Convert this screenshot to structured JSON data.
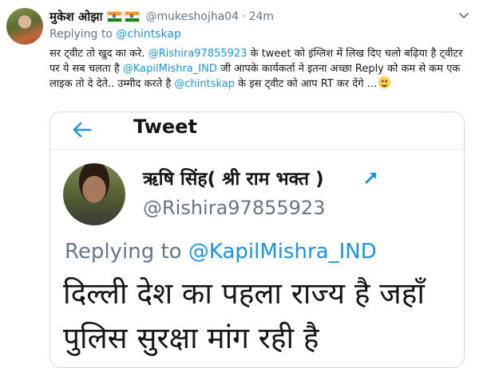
{
  "tweet": {
    "author_name": "मुकेश ओझा",
    "handle": "@mukeshojha04",
    "separator": "·",
    "time": "24m",
    "replying_prefix": "Replying to",
    "replying_to": "@chintskap",
    "body": {
      "t1": "सर ट्वीट तो खुद का करे. ",
      "m1": "@Rishira97855923",
      "t2": " के tweet को इंग्लिश में लिख दिए चलो बढ़िया है ट्वीटर पर ये सब चलता है ",
      "m2": "@KapilMishra_IND",
      "t3": " जी आपके कार्यकर्ता ने इतना अच्छा Reply को कम से कम एक लाइक तो दे देते.. उम्मीद करते है ",
      "m3": "@chintskap",
      "t4": " के इस ट्वीट को आप RT कर देंगे ..."
    }
  },
  "screenshot": {
    "header_title": "Tweet",
    "author_name": "ऋषि सिंह( श्री राम भक्त )",
    "handle": "@Rishira97855923",
    "replying_prefix": "Replying to",
    "replying_to": "@KapilMishra_IND",
    "body": "दिल्ली देश का पहला राज्य है जहाँ पुलिस सुरक्षा मांग रही है"
  },
  "colors": {
    "link": "#1b95e0",
    "muted": "#657786",
    "text": "#14171a"
  },
  "icons": [
    "more-chevron-icon",
    "india-flag-icon",
    "smiley-emoji-icon",
    "back-arrow-icon",
    "pinned-arrow-icon"
  ]
}
